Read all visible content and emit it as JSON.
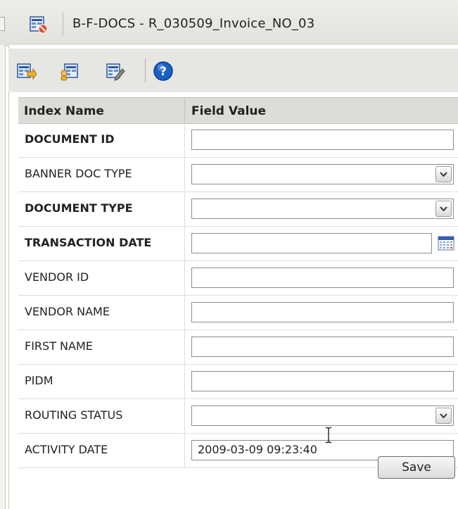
{
  "window": {
    "title": "B-F-DOCS - R_030509_Invoice_NO_03",
    "title_icon": "document-image-icon"
  },
  "toolbar": {
    "buttons": [
      {
        "name": "import-index-icon"
      },
      {
        "name": "user-index-icon"
      },
      {
        "name": "edit-index-icon"
      },
      {
        "name": "help-icon",
        "glyph": "?"
      }
    ]
  },
  "table": {
    "headers": {
      "index_name": "Index Name",
      "field_value": "Field Value"
    },
    "rows": [
      {
        "label": "DOCUMENT ID",
        "bold": true,
        "type": "text",
        "value": ""
      },
      {
        "label": "BANNER DOC TYPE",
        "bold": false,
        "type": "select",
        "value": ""
      },
      {
        "label": "DOCUMENT TYPE",
        "bold": true,
        "type": "select",
        "value": ""
      },
      {
        "label": "TRANSACTION DATE",
        "bold": true,
        "type": "date",
        "value": ""
      },
      {
        "label": "VENDOR ID",
        "bold": false,
        "type": "text",
        "value": ""
      },
      {
        "label": "VENDOR NAME",
        "bold": false,
        "type": "text",
        "value": ""
      },
      {
        "label": "FIRST NAME",
        "bold": false,
        "type": "text",
        "value": ""
      },
      {
        "label": "PIDM",
        "bold": false,
        "type": "text",
        "value": ""
      },
      {
        "label": "ROUTING STATUS",
        "bold": false,
        "type": "select",
        "value": ""
      },
      {
        "label": "ACTIVITY DATE",
        "bold": false,
        "type": "text",
        "value": "2009-03-09 09:23:40"
      }
    ]
  },
  "actions": {
    "save_label": "Save"
  },
  "colors": {
    "toolbar_bg": "#e6e6e2",
    "header_bg": "#dcdcd8",
    "help_blue": "#1a5fc8"
  }
}
